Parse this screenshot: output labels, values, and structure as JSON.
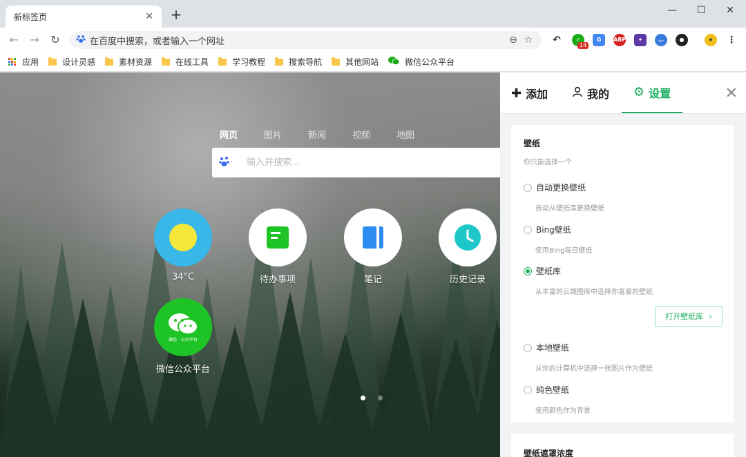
{
  "browser": {
    "tab_title": "新标签页",
    "tab_close": "✕",
    "new_tab": "+",
    "win_min": "—",
    "win_max": "☐",
    "win_close": "✕",
    "address_placeholder": "在百度中搜索，或者输入一个网址",
    "ext_badge": "14"
  },
  "bookmarks": [
    {
      "label": "应用"
    },
    {
      "label": "设计灵感"
    },
    {
      "label": "素材资源"
    },
    {
      "label": "在线工具"
    },
    {
      "label": "学习教程"
    },
    {
      "label": "搜索导航"
    },
    {
      "label": "其他网站"
    },
    {
      "label": "微信公众平台"
    }
  ],
  "newtab": {
    "search_tabs": [
      "网页",
      "图片",
      "新闻",
      "视频",
      "地图"
    ],
    "search_placeholder": "输入并搜索...",
    "apps": [
      {
        "label": "34°C",
        "color": "#38b7e8"
      },
      {
        "label": "待办事项",
        "color": "#ffffff"
      },
      {
        "label": "笔记",
        "color": "#ffffff"
      },
      {
        "label": "历史记录",
        "color": "#ffffff"
      },
      {
        "label": "微信公众平台",
        "color": "#1ec426",
        "inner_text": "微信 · 公众平台"
      }
    ]
  },
  "panel": {
    "tabs": [
      {
        "label": "添加",
        "icon": "plus-icon"
      },
      {
        "label": "我的",
        "icon": "user-icon"
      },
      {
        "label": "设置",
        "icon": "gear-icon",
        "active": true
      }
    ],
    "wallpaper": {
      "title": "壁纸",
      "subtitle": "你只能选择一个",
      "options": [
        {
          "label": "自动更换壁纸",
          "desc": "自动从壁纸库更换壁纸",
          "selected": false
        },
        {
          "label": "Bing壁纸",
          "desc": "使用Bing每日壁纸",
          "selected": false
        },
        {
          "label": "壁纸库",
          "desc": "从丰富的云端图库中选择你喜爱的壁纸",
          "selected": true
        },
        {
          "label": "本地壁纸",
          "desc": "从你的计算机中选择一张图片作为壁纸",
          "selected": false
        },
        {
          "label": "纯色壁纸",
          "desc": "使用颜色作为背景",
          "selected": false
        }
      ],
      "open_button": "打开壁纸库"
    },
    "mask": {
      "title": "壁纸遮罩浓度"
    }
  },
  "colors": {
    "accent": "#1aad5e"
  }
}
